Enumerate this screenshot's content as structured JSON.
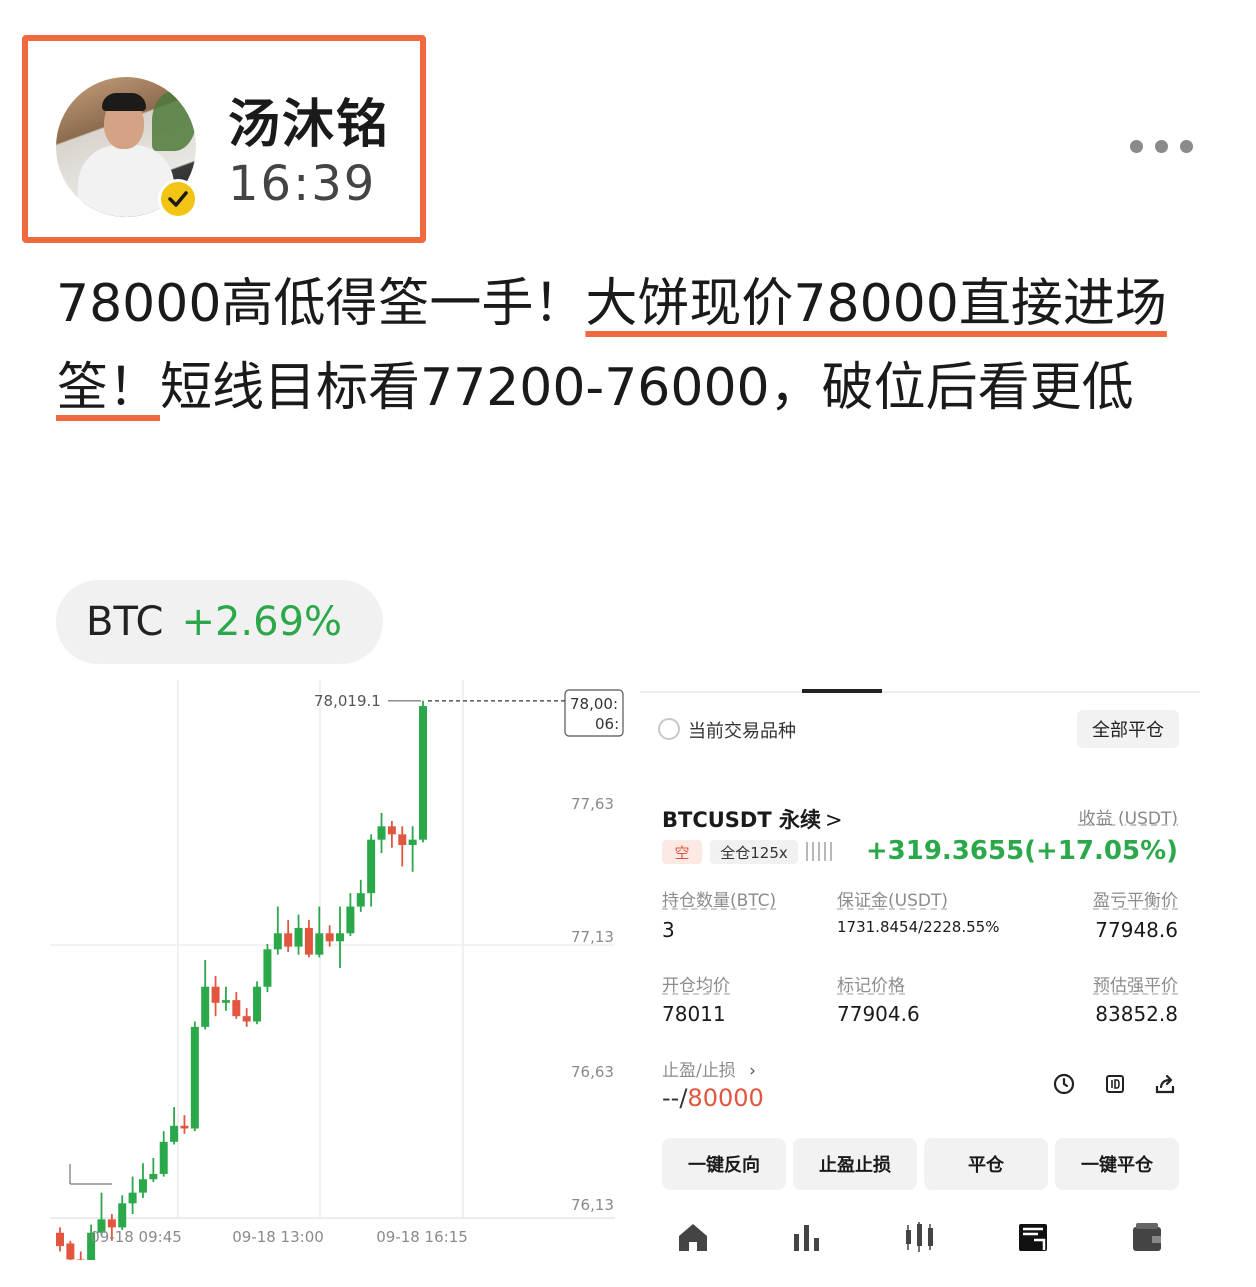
{
  "header": {
    "author_name": "汤沐铭",
    "post_time": "16:39"
  },
  "post": {
    "text_part1": "78000高低得筌一手！",
    "text_highlight1": "大饼现价78000直接进场筌！",
    "text_part2": "短线目标看77200-76000，破位后看更低"
  },
  "tag": {
    "symbol": "BTC",
    "change": "+2.69%"
  },
  "chart_data": {
    "type": "candlestick",
    "y_tick_labels": [
      "78,00:",
      "77,63",
      "77,13",
      "76,63",
      "76,13"
    ],
    "y_ticks": [
      78000,
      77630,
      77130,
      76630,
      76130
    ],
    "x_tick_labels": [
      "09-18 09:45",
      "09-18 13:00",
      "09-18 16:15"
    ],
    "last_price_label": "06:",
    "high_label": "78,019.1",
    "high_value": 78019.1,
    "candles": [
      [
        76030,
        75980,
        76050,
        75960
      ],
      [
        75990,
        75930,
        76000,
        75920
      ],
      [
        75930,
        75890,
        75960,
        75850
      ],
      [
        75890,
        76030,
        76060,
        75880
      ],
      [
        76030,
        76080,
        76180,
        76020
      ],
      [
        76080,
        76050,
        76100,
        76000
      ],
      [
        76050,
        76140,
        76170,
        76040
      ],
      [
        76140,
        76180,
        76240,
        76100
      ],
      [
        76180,
        76230,
        76290,
        76160
      ],
      [
        76230,
        76250,
        76310,
        76220
      ],
      [
        76250,
        76370,
        76410,
        76240
      ],
      [
        76370,
        76430,
        76500,
        76360
      ],
      [
        76430,
        76420,
        76470,
        76400
      ],
      [
        76420,
        76800,
        76820,
        76410
      ],
      [
        76800,
        76950,
        77050,
        76790
      ],
      [
        76950,
        76890,
        76990,
        76840
      ],
      [
        76890,
        76900,
        76950,
        76860
      ],
      [
        76900,
        76840,
        76930,
        76830
      ],
      [
        76840,
        76820,
        76870,
        76800
      ],
      [
        76820,
        76950,
        76970,
        76810
      ],
      [
        76950,
        77090,
        77110,
        76930
      ],
      [
        77090,
        77150,
        77250,
        77070
      ],
      [
        77150,
        77100,
        77200,
        77080
      ],
      [
        77100,
        77170,
        77220,
        77070
      ],
      [
        77170,
        77070,
        77200,
        77060
      ],
      [
        77070,
        77150,
        77250,
        77060
      ],
      [
        77150,
        77120,
        77180,
        77100
      ],
      [
        77120,
        77150,
        77250,
        77020
      ],
      [
        77150,
        77250,
        77300,
        77140
      ],
      [
        77250,
        77300,
        77350,
        77230
      ],
      [
        77300,
        77500,
        77520,
        77250
      ],
      [
        77500,
        77550,
        77600,
        77450
      ],
      [
        77550,
        77520,
        77570,
        77470
      ],
      [
        77520,
        77480,
        77550,
        77400
      ],
      [
        77480,
        77500,
        77550,
        77380
      ],
      [
        77500,
        78000,
        78020,
        77490
      ]
    ]
  },
  "panel": {
    "current_pair_label": "当前交易品种",
    "close_all": "全部平仓",
    "pair_name": "BTCUSDT 永续",
    "pair_chevron": ">",
    "pnl_label": "收益 (USDT)",
    "side": "空",
    "leverage": "全仓125x",
    "pnl_value": "+319.3655(+17.05%)",
    "fields": {
      "qty_label": "持仓数量(BTC)",
      "qty_value": "3",
      "margin_label": "保证金(USDT)",
      "margin_value": "1731.8454/2228.55%",
      "breakeven_label": "盈亏平衡价",
      "breakeven_value": "77948.6",
      "entry_label": "开仓均价",
      "entry_value": "78011",
      "mark_label": "标记价格",
      "mark_value": "77904.6",
      "liq_label": "预估强平价",
      "liq_value": "83852.8"
    },
    "tpsl_label": "止盈/止损",
    "tpsl_chevron": "›",
    "tpsl_tp": "--",
    "tpsl_sep": "/",
    "tpsl_sl": "80000",
    "buttons": [
      "一键反向",
      "止盈止损",
      "平仓",
      "一键平仓"
    ]
  },
  "colors": {
    "up": "#2aa84a",
    "down": "#e2563f",
    "highlight": "#f06a3f"
  }
}
